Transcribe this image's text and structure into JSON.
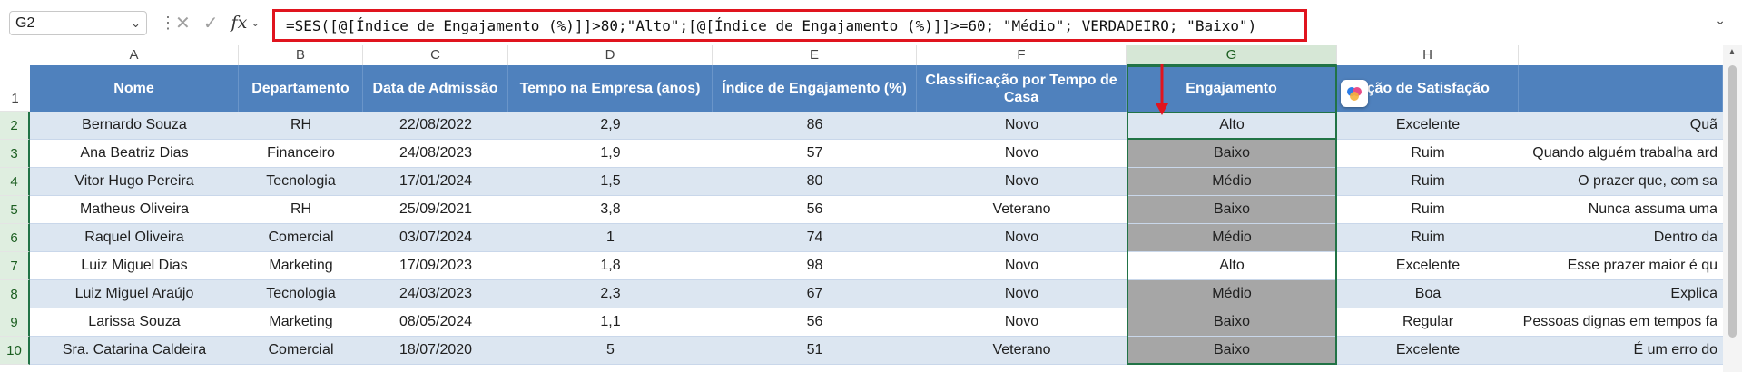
{
  "formula_bar": {
    "name_box": "G2",
    "formula": "=SES([@[Índice de Engajamento (%)]]>80;\"Alto\";[@[Índice de Engajamento (%)]]>=60; \"Médio\"; VERDADEIRO; \"Baixo\")"
  },
  "columns": [
    "A",
    "B",
    "C",
    "D",
    "E",
    "F",
    "G",
    "H"
  ],
  "selected_column": "G",
  "row_numbers": [
    "1",
    "2",
    "3",
    "4",
    "5",
    "6",
    "7",
    "8",
    "9",
    "10"
  ],
  "headers": {
    "nome": "Nome",
    "departamento": "Departamento",
    "data_admissao": "Data de Admissão",
    "tempo_empresa": "Tempo na Empresa (anos)",
    "indice_engajamento": "Índice de Engajamento (%)",
    "classificacao_tempo": "Classificação por Tempo de Casa",
    "engajamento": "Engajamento",
    "avaliacao_satisfacao": "aliação de Satisfação"
  },
  "rows": [
    {
      "nome": "Bernardo Souza",
      "departamento": "RH",
      "data": "22/08/2022",
      "tempo": "2,9",
      "indice": "86",
      "classificacao": "Novo",
      "engajamento": "Alto",
      "avaliacao": "Excelente",
      "comentario": "Quã"
    },
    {
      "nome": "Ana Beatriz Dias",
      "departamento": "Financeiro",
      "data": "24/08/2023",
      "tempo": "1,9",
      "indice": "57",
      "classificacao": "Novo",
      "engajamento": "Baixo",
      "avaliacao": "Ruim",
      "comentario": "Quando alguém trabalha ard"
    },
    {
      "nome": "Vitor Hugo Pereira",
      "departamento": "Tecnologia",
      "data": "17/01/2024",
      "tempo": "1,5",
      "indice": "80",
      "classificacao": "Novo",
      "engajamento": "Médio",
      "avaliacao": "Ruim",
      "comentario": "O prazer que, com sa"
    },
    {
      "nome": "Matheus Oliveira",
      "departamento": "RH",
      "data": "25/09/2021",
      "tempo": "3,8",
      "indice": "56",
      "classificacao": "Veterano",
      "engajamento": "Baixo",
      "avaliacao": "Ruim",
      "comentario": "Nunca assuma uma"
    },
    {
      "nome": "Raquel Oliveira",
      "departamento": "Comercial",
      "data": "03/07/2024",
      "tempo": "1",
      "indice": "74",
      "classificacao": "Novo",
      "engajamento": "Médio",
      "avaliacao": "Ruim",
      "comentario": "Dentro da"
    },
    {
      "nome": "Luiz Miguel Dias",
      "departamento": "Marketing",
      "data": "17/09/2023",
      "tempo": "1,8",
      "indice": "98",
      "classificacao": "Novo",
      "engajamento": "Alto",
      "avaliacao": "Excelente",
      "comentario": "Esse prazer maior é qu"
    },
    {
      "nome": "Luiz Miguel Araújo",
      "departamento": "Tecnologia",
      "data": "24/03/2023",
      "tempo": "2,3",
      "indice": "67",
      "classificacao": "Novo",
      "engajamento": "Médio",
      "avaliacao": "Boa",
      "comentario": "Explica"
    },
    {
      "nome": "Larissa Souza",
      "departamento": "Marketing",
      "data": "08/05/2024",
      "tempo": "1,1",
      "indice": "56",
      "classificacao": "Novo",
      "engajamento": "Baixo",
      "avaliacao": "Regular",
      "comentario": "Pessoas dignas em tempos fa"
    },
    {
      "nome": "Sra. Catarina Caldeira",
      "departamento": "Comercial",
      "data": "18/07/2020",
      "tempo": "5",
      "indice": "51",
      "classificacao": "Veterano",
      "engajamento": "Baixo",
      "avaliacao": "Excelente",
      "comentario": "É um erro do"
    }
  ],
  "colors": {
    "header_blue": "#4f81bd",
    "band_blue": "#dce6f1",
    "gray_fill": "#a6a6a6",
    "selection_green": "#217346",
    "highlight_red": "#e0141e"
  },
  "icons": [
    "chevron-down-icon",
    "cancel-icon",
    "enter-icon",
    "function-icon",
    "copilot-icon",
    "scroll-up-icon"
  ]
}
